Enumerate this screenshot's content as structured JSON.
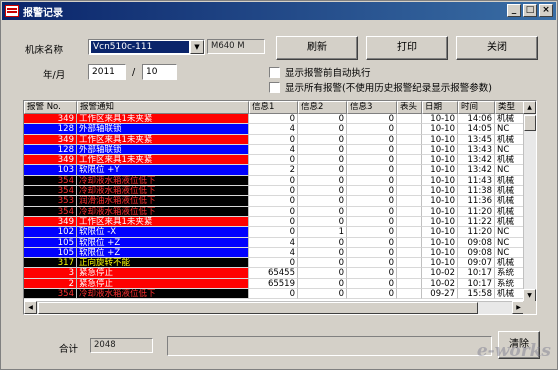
{
  "window": {
    "title": "报警记录",
    "min": "_",
    "max": "□",
    "close": "×"
  },
  "form": {
    "machine_label": "机床名称",
    "machine_value": "Vcn510c-111",
    "machine_info": "M640 M",
    "date_label": "年/月",
    "year": "2011",
    "slash": "/",
    "month": "10",
    "refresh": "刷新",
    "print": "打印",
    "close": "关闭",
    "chk_auto": "显示报警前自动执行",
    "chk_all": "显示所有报警(不使用历史报警纪录显示报警参数)"
  },
  "table": {
    "columns": [
      "报警 No.",
      "报警通知",
      "信息1",
      "信息2",
      "信息3",
      "表头",
      "日期",
      "时间",
      "类型"
    ],
    "rows": [
      {
        "no": "349",
        "msg": "工作区来具1未夹紧",
        "i1": "0",
        "i2": "0",
        "i3": "0",
        "hd": "",
        "date": "10-10",
        "time": "14:06",
        "type": "机械",
        "bg": "#ff0000",
        "fg": "#ffffff"
      },
      {
        "no": "128",
        "msg": "外部轴联锁",
        "i1": "4",
        "i2": "0",
        "i3": "0",
        "hd": "",
        "date": "10-10",
        "time": "14:05",
        "type": "NC",
        "bg": "#0000ff",
        "fg": "#ffffff"
      },
      {
        "no": "349",
        "msg": "工作区来具1未夹紧",
        "i1": "0",
        "i2": "0",
        "i3": "0",
        "hd": "",
        "date": "10-10",
        "time": "13:45",
        "type": "机械",
        "bg": "#ff0000",
        "fg": "#ffffff"
      },
      {
        "no": "128",
        "msg": "外部轴联锁",
        "i1": "4",
        "i2": "0",
        "i3": "0",
        "hd": "",
        "date": "10-10",
        "time": "13:43",
        "type": "NC",
        "bg": "#0000ff",
        "fg": "#ffffff"
      },
      {
        "no": "349",
        "msg": "工作区来具1未夹紧",
        "i1": "0",
        "i2": "0",
        "i3": "0",
        "hd": "",
        "date": "10-10",
        "time": "13:42",
        "type": "机械",
        "bg": "#ff0000",
        "fg": "#ffffff"
      },
      {
        "no": "103",
        "msg": "软限位 +Y",
        "i1": "2",
        "i2": "0",
        "i3": "0",
        "hd": "",
        "date": "10-10",
        "time": "13:42",
        "type": "NC",
        "bg": "#0000ff",
        "fg": "#ffffff"
      },
      {
        "no": "354",
        "msg": "冷却液水箱液位低下",
        "i1": "0",
        "i2": "0",
        "i3": "0",
        "hd": "",
        "date": "10-10",
        "time": "11:43",
        "type": "机械",
        "bg": "#000000",
        "fg": "#ff3030"
      },
      {
        "no": "354",
        "msg": "冷却液水箱液位低下",
        "i1": "0",
        "i2": "0",
        "i3": "0",
        "hd": "",
        "date": "10-10",
        "time": "11:38",
        "type": "机械",
        "bg": "#000000",
        "fg": "#ff3030"
      },
      {
        "no": "353",
        "msg": "润滑油水箱液位低下",
        "i1": "0",
        "i2": "0",
        "i3": "0",
        "hd": "",
        "date": "10-10",
        "time": "11:36",
        "type": "机械",
        "bg": "#000000",
        "fg": "#ff3030"
      },
      {
        "no": "354",
        "msg": "冷却液水箱液位低下",
        "i1": "0",
        "i2": "0",
        "i3": "0",
        "hd": "",
        "date": "10-10",
        "time": "11:20",
        "type": "机械",
        "bg": "#000000",
        "fg": "#ff3030"
      },
      {
        "no": "349",
        "msg": "工作区来具1未夹紧",
        "i1": "0",
        "i2": "0",
        "i3": "0",
        "hd": "",
        "date": "10-10",
        "time": "11:22",
        "type": "机械",
        "bg": "#ff0000",
        "fg": "#ffffff"
      },
      {
        "no": "102",
        "msg": "软限位 -X",
        "i1": "0",
        "i2": "1",
        "i3": "0",
        "hd": "",
        "date": "10-10",
        "time": "11:20",
        "type": "NC",
        "bg": "#0000ff",
        "fg": "#ffffff"
      },
      {
        "no": "105",
        "msg": "软限位 +Z",
        "i1": "4",
        "i2": "0",
        "i3": "0",
        "hd": "",
        "date": "10-10",
        "time": "09:08",
        "type": "NC",
        "bg": "#0000ff",
        "fg": "#ffffff"
      },
      {
        "no": "105",
        "msg": "软限位 +Z",
        "i1": "4",
        "i2": "0",
        "i3": "0",
        "hd": "",
        "date": "10-10",
        "time": "09:08",
        "type": "NC",
        "bg": "#0000ff",
        "fg": "#ffffff"
      },
      {
        "no": "317",
        "msg": "正向旋转不能",
        "i1": "0",
        "i2": "0",
        "i3": "0",
        "hd": "",
        "date": "10-10",
        "time": "09:07",
        "type": "机械",
        "bg": "#000000",
        "fg": "#ffff00"
      },
      {
        "no": "3",
        "msg": "紧急停止",
        "i1": "65455",
        "i2": "0",
        "i3": "0",
        "hd": "",
        "date": "10-02",
        "time": "10:17",
        "type": "系统",
        "bg": "#ff0000",
        "fg": "#ffffff"
      },
      {
        "no": "2",
        "msg": "紧急停止",
        "i1": "65519",
        "i2": "0",
        "i3": "0",
        "hd": "",
        "date": "10-02",
        "time": "10:17",
        "type": "系统",
        "bg": "#ff0000",
        "fg": "#ffffff"
      },
      {
        "no": "354",
        "msg": "冷却液水箱液位低下",
        "i1": "0",
        "i2": "0",
        "i3": "0",
        "hd": "",
        "date": "09-27",
        "time": "15:58",
        "type": "机械",
        "bg": "#000000",
        "fg": "#ff3030"
      }
    ]
  },
  "footer": {
    "total_label": "合计",
    "total_value": "2048",
    "clear": "清除"
  },
  "watermark": "e-works"
}
